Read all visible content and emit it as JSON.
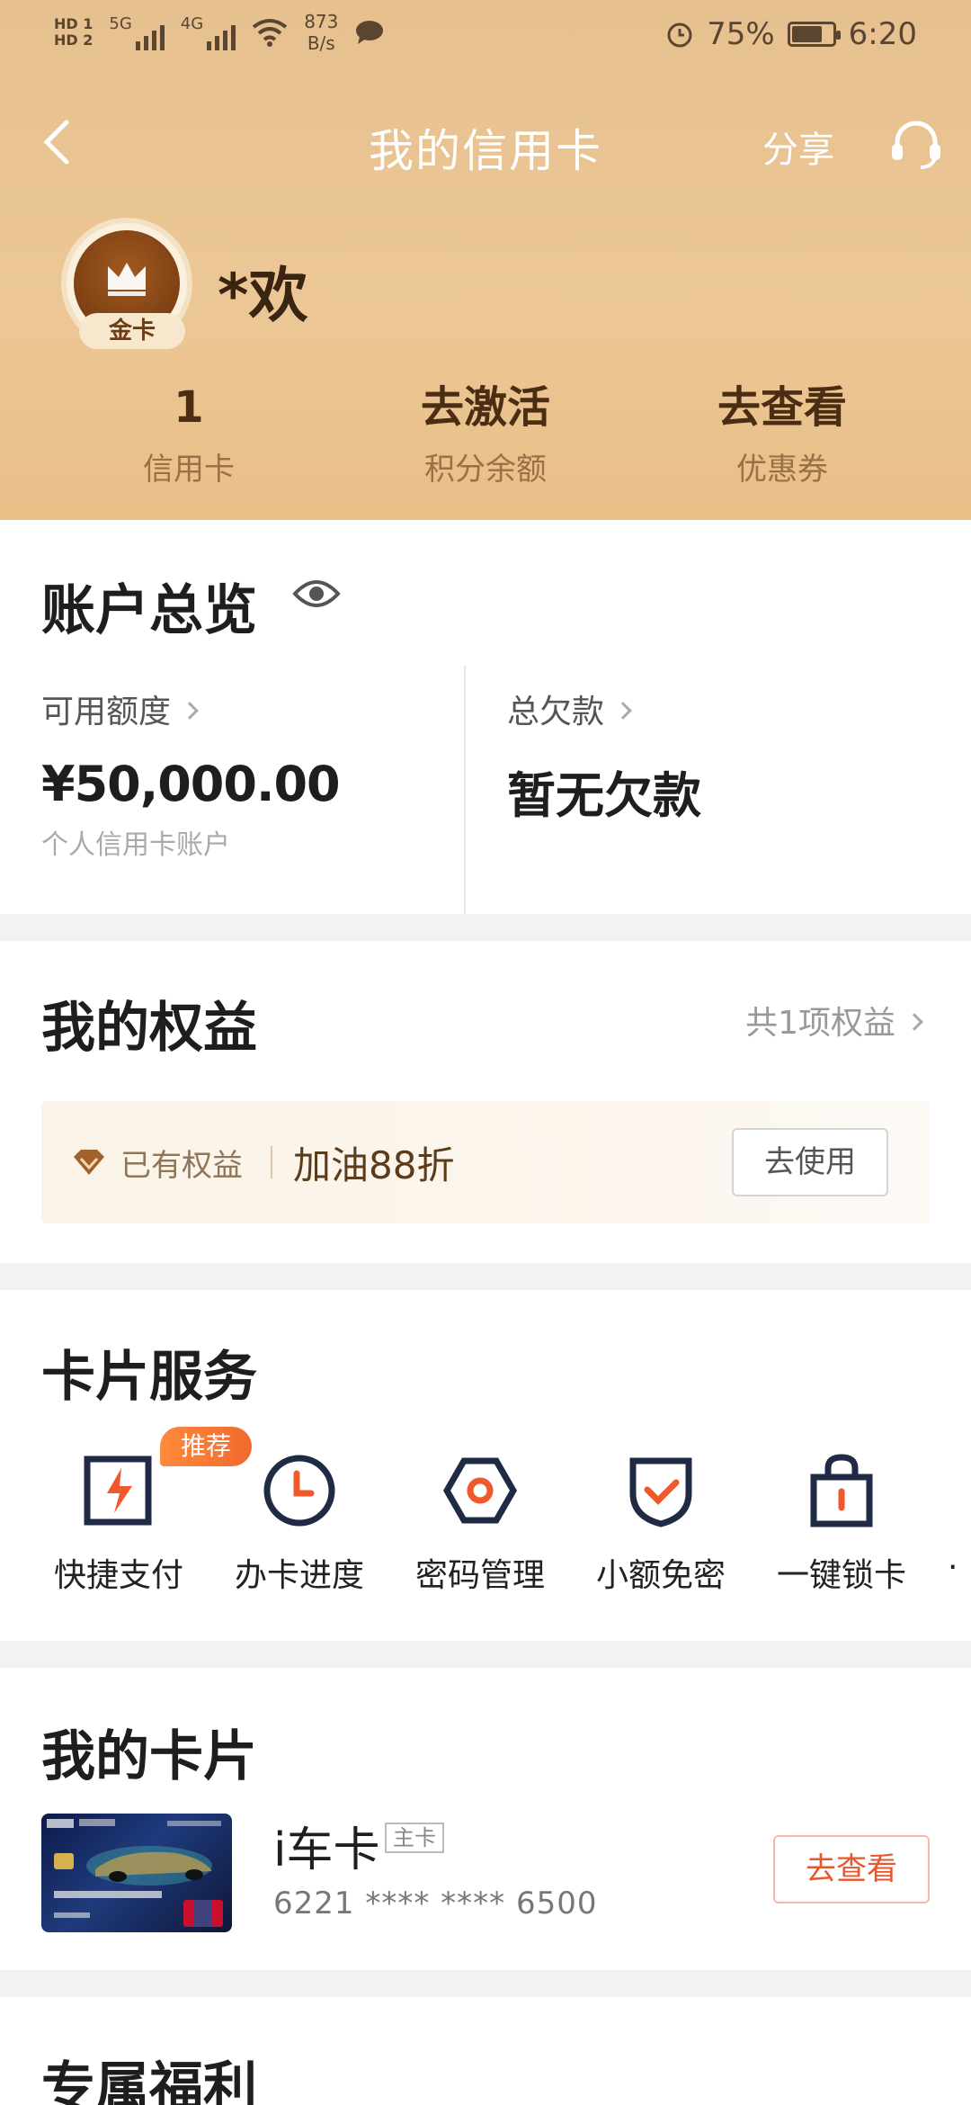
{
  "status_bar": {
    "hd1": "HD 1",
    "hd2": "HD 2",
    "net1": "5G",
    "net2": "4G",
    "speed_value": "873",
    "speed_unit": "B/s",
    "battery": "75%",
    "time": "6:20"
  },
  "nav": {
    "title": "我的信用卡",
    "share": "分享"
  },
  "profile": {
    "badge": "金卡",
    "name": "*欢"
  },
  "stats": [
    {
      "value": "1",
      "label": "信用卡"
    },
    {
      "value": "去激活",
      "label": "积分余额"
    },
    {
      "value": "去查看",
      "label": "优惠券"
    }
  ],
  "overview": {
    "title": "账户总览",
    "available_label": "可用额度",
    "available_amount": "¥50,000.00",
    "available_sub": "个人信用卡账户",
    "debt_label": "总欠款",
    "debt_value": "暂无欠款"
  },
  "benefits": {
    "title": "我的权益",
    "count": "共1项权益",
    "have_label": "已有权益",
    "benefit_name": "加油88折",
    "use_button": "去使用"
  },
  "services": {
    "title": "卡片服务",
    "recommend_badge": "推荐",
    "items": [
      {
        "label": "快捷支付",
        "icon": "quick-pay-icon"
      },
      {
        "label": "办卡进度",
        "icon": "clock-icon"
      },
      {
        "label": "密码管理",
        "icon": "hex-lock-icon"
      },
      {
        "label": "小额免密",
        "icon": "shield-check-icon"
      },
      {
        "label": "一键锁卡",
        "icon": "bag-lock-icon"
      }
    ]
  },
  "my_cards": {
    "title": "我的卡片",
    "card_name": "i车卡",
    "card_tag": "主卡",
    "card_number": "6221 **** **** 6500",
    "view_button": "去查看"
  },
  "welfare": {
    "title": "专属福利"
  },
  "colors": {
    "header_gold": "#e8c18f",
    "accent_orange": "#e8562b",
    "navy_icon": "#1f2a44"
  }
}
